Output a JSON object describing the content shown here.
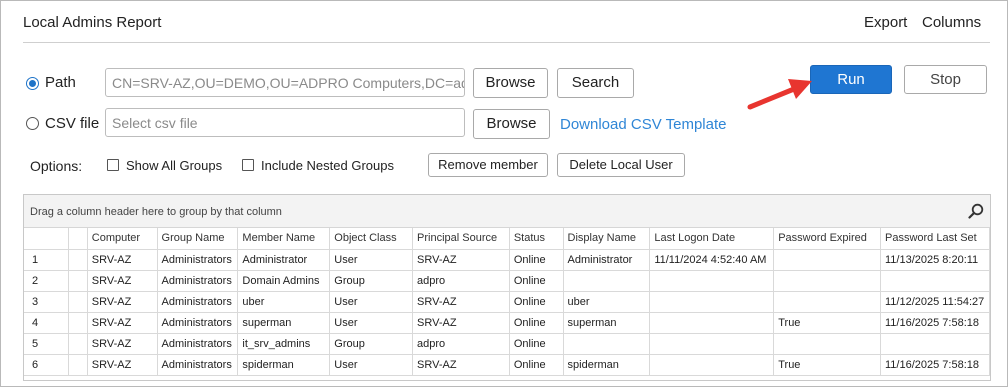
{
  "window": {
    "title": "Local Admins Report"
  },
  "menu": {
    "export": "Export",
    "columns": "Columns"
  },
  "source": {
    "path_label": "Path",
    "path_value": "CN=SRV-AZ,OU=DEMO,OU=ADPRO Computers,DC=ad,D",
    "csv_label": "CSV file",
    "csv_placeholder": "Select csv file",
    "browse_path": "Browse",
    "search": "Search",
    "browse_csv": "Browse",
    "download_template": "Download CSV Template"
  },
  "actions": {
    "run": "Run",
    "stop": "Stop"
  },
  "options": {
    "label": "Options:",
    "show_all_groups": "Show All Groups",
    "include_nested_groups": "Include Nested Groups",
    "remove_member": "Remove member",
    "delete_local_user": "Delete Local User"
  },
  "grid": {
    "group_hint": "Drag a column header here to group by that column",
    "columns": [
      "Computer",
      "Group Name",
      "Member Name",
      "Object Class",
      "Principal Source",
      "Status",
      "Display Name",
      "Last Logon Date",
      "Password Expired",
      "Password Last Set"
    ],
    "rows": [
      [
        "1",
        "SRV-AZ",
        "Administrators",
        "Administrator",
        "User",
        "SRV-AZ",
        "Online",
        "Administrator",
        "11/11/2024 4:52:40 AM",
        "",
        "11/13/2025 8:20:11"
      ],
      [
        "2",
        "SRV-AZ",
        "Administrators",
        "Domain Admins",
        "Group",
        "adpro",
        "Online",
        "",
        "",
        "",
        ""
      ],
      [
        "3",
        "SRV-AZ",
        "Administrators",
        "uber",
        "User",
        "SRV-AZ",
        "Online",
        "uber",
        "",
        "",
        "11/12/2025 11:54:27"
      ],
      [
        "4",
        "SRV-AZ",
        "Administrators",
        "superman",
        "User",
        "SRV-AZ",
        "Online",
        "superman",
        "",
        "True",
        "11/16/2025 7:58:18"
      ],
      [
        "5",
        "SRV-AZ",
        "Administrators",
        "it_srv_admins",
        "Group",
        "adpro",
        "Online",
        "",
        "",
        "",
        ""
      ],
      [
        "6",
        "SRV-AZ",
        "Administrators",
        "spiderman",
        "User",
        "SRV-AZ",
        "Online",
        "spiderman",
        "",
        "True",
        "11/16/2025 7:58:18"
      ]
    ]
  },
  "colors": {
    "accent": "#1f76d2",
    "link": "#2f86d6",
    "arrow": "#e8352f"
  }
}
